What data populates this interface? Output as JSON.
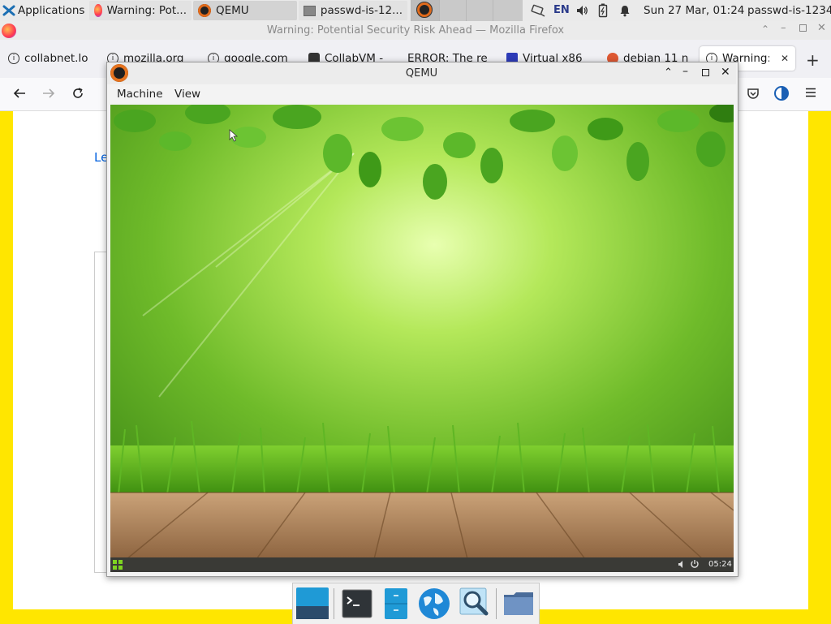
{
  "top_panel": {
    "applications_label": "Applications",
    "tasks": [
      {
        "label": "Warning: Pot...",
        "icon": "firefox-icon"
      },
      {
        "label": "QEMU",
        "icon": "qemu-icon"
      },
      {
        "label": "passwd-is-12...",
        "icon": "window-icon"
      }
    ],
    "tray": {
      "keyboard_layout": "EN",
      "clock": "Sun 27 Mar, 01:24",
      "hostname": "passwd-is-1234"
    }
  },
  "firefox": {
    "window_title": "Warning: Potential Security Risk Ahead — Mozilla Firefox",
    "tabs": [
      {
        "label": "collabnet.lo"
      },
      {
        "label": "mozilla.org"
      },
      {
        "label": "google.com"
      },
      {
        "label": "CollabVM -"
      },
      {
        "label": "ERROR: The re"
      },
      {
        "label": "Virtual x86"
      },
      {
        "label": "debian 11 n"
      },
      {
        "label": "Warning:"
      }
    ],
    "page_link_fragment": "Le"
  },
  "qemu": {
    "title": "QEMU",
    "menu": [
      "Machine",
      "View"
    ],
    "guest": {
      "clock": "05:24"
    }
  },
  "colors": {
    "desktop_yellow": "#ffe600",
    "accent_blue": "#1b9bd8"
  }
}
